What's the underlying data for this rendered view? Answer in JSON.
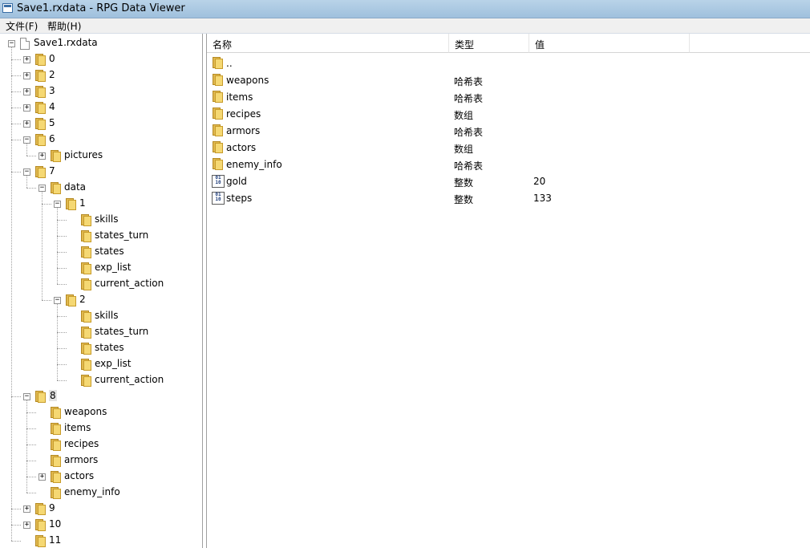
{
  "window": {
    "title": "Save1.rxdata - RPG Data Viewer"
  },
  "menu": {
    "items": [
      "文件(F)",
      "帮助(H)"
    ]
  },
  "tree": {
    "nodes": [
      {
        "label": "Save1.rxdata",
        "icon": "document-icon",
        "expander": "minus"
      },
      {
        "label": "0",
        "icon": "folder-icon",
        "expander": "plus"
      },
      {
        "label": "2",
        "icon": "folder-icon",
        "expander": "plus"
      },
      {
        "label": "3",
        "icon": "folder-icon",
        "expander": "plus"
      },
      {
        "label": "4",
        "icon": "folder-icon",
        "expander": "plus"
      },
      {
        "label": "5",
        "icon": "folder-icon",
        "expander": "plus"
      },
      {
        "label": "6",
        "icon": "folder-icon",
        "expander": "minus"
      },
      {
        "label": "pictures",
        "icon": "folder-icon",
        "expander": "plus"
      },
      {
        "label": "7",
        "icon": "folder-icon",
        "expander": "minus"
      },
      {
        "label": "data",
        "icon": "folder-icon",
        "expander": "minus"
      },
      {
        "label": "1",
        "icon": "folder-icon",
        "expander": "minus"
      },
      {
        "label": "skills",
        "icon": "folder-icon",
        "expander": ""
      },
      {
        "label": "states_turn",
        "icon": "folder-icon",
        "expander": ""
      },
      {
        "label": "states",
        "icon": "folder-icon",
        "expander": ""
      },
      {
        "label": "exp_list",
        "icon": "folder-icon",
        "expander": ""
      },
      {
        "label": "current_action",
        "icon": "folder-icon",
        "expander": ""
      },
      {
        "label": "2",
        "icon": "folder-icon",
        "expander": "minus"
      },
      {
        "label": "skills",
        "icon": "folder-icon",
        "expander": ""
      },
      {
        "label": "states_turn",
        "icon": "folder-icon",
        "expander": ""
      },
      {
        "label": "states",
        "icon": "folder-icon",
        "expander": ""
      },
      {
        "label": "exp_list",
        "icon": "folder-icon",
        "expander": ""
      },
      {
        "label": "current_action",
        "icon": "folder-icon",
        "expander": ""
      },
      {
        "label": "8",
        "icon": "folder-icon",
        "expander": "minus",
        "selected": true
      },
      {
        "label": "weapons",
        "icon": "folder-icon",
        "expander": ""
      },
      {
        "label": "items",
        "icon": "folder-icon",
        "expander": ""
      },
      {
        "label": "recipes",
        "icon": "folder-icon",
        "expander": ""
      },
      {
        "label": "armors",
        "icon": "folder-icon",
        "expander": ""
      },
      {
        "label": "actors",
        "icon": "folder-icon",
        "expander": "plus"
      },
      {
        "label": "enemy_info",
        "icon": "folder-icon",
        "expander": ""
      },
      {
        "label": "9",
        "icon": "folder-icon",
        "expander": "plus"
      },
      {
        "label": "10",
        "icon": "folder-icon",
        "expander": "plus"
      },
      {
        "label": "11",
        "icon": "folder-icon",
        "expander": ""
      }
    ]
  },
  "list": {
    "columns": [
      "名称",
      "类型",
      "值"
    ],
    "rows": [
      {
        "name": "..",
        "type": "",
        "value": "",
        "icon": "folder-icon"
      },
      {
        "name": "weapons",
        "type": "哈希表",
        "value": "",
        "icon": "folder-icon"
      },
      {
        "name": "items",
        "type": "哈希表",
        "value": "",
        "icon": "folder-icon"
      },
      {
        "name": "recipes",
        "type": "数组",
        "value": "",
        "icon": "folder-icon"
      },
      {
        "name": "armors",
        "type": "哈希表",
        "value": "",
        "icon": "folder-icon"
      },
      {
        "name": "actors",
        "type": "数组",
        "value": "",
        "icon": "folder-icon"
      },
      {
        "name": "enemy_info",
        "type": "哈希表",
        "value": "",
        "icon": "folder-icon"
      },
      {
        "name": "gold",
        "type": "整数",
        "value": "20",
        "icon": "integer-icon"
      },
      {
        "name": "steps",
        "type": "整数",
        "value": "133",
        "icon": "integer-icon"
      }
    ]
  },
  "colors": {
    "titlebar": "#b9d3e8",
    "folder": "#f5d873",
    "selection": "#e3e3e3"
  }
}
